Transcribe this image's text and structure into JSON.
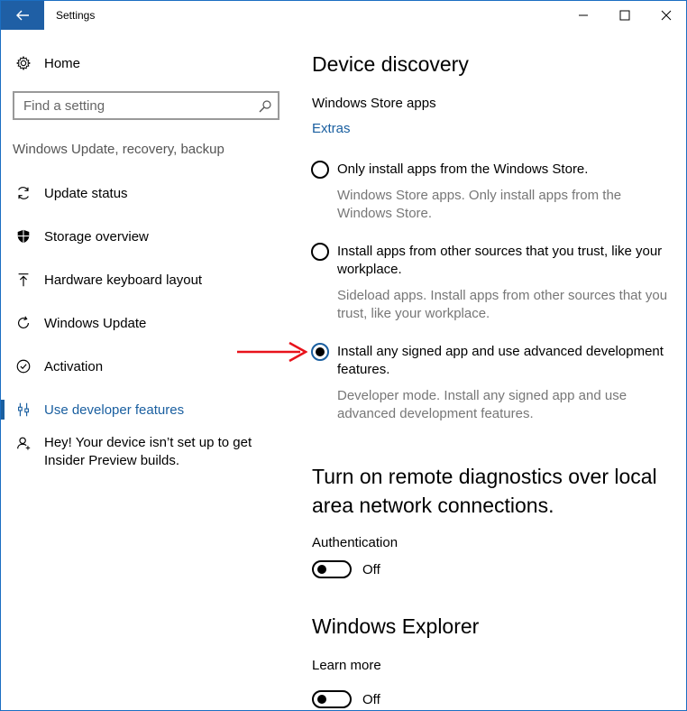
{
  "window": {
    "title": "Settings"
  },
  "sidebar": {
    "home_label": "Home",
    "search_placeholder": "Find a setting",
    "section_label": "Windows Update, recovery, backup",
    "items": [
      {
        "label": "Update status",
        "icon": "refresh-icon"
      },
      {
        "label": "Storage overview",
        "icon": "shield-icon"
      },
      {
        "label": "Hardware keyboard layout",
        "icon": "upload-arrow-icon"
      },
      {
        "label": "Windows Update",
        "icon": "sync-icon"
      },
      {
        "label": "Activation",
        "icon": "check-circle-icon"
      },
      {
        "label": "Use developer features",
        "icon": "developer-tools-icon",
        "active": true
      },
      {
        "label": "Hey! Your device isn’t set up to get Insider Preview builds.",
        "icon": "person-icon"
      }
    ]
  },
  "main": {
    "device_discovery": {
      "title": "Device discovery",
      "subtitle": "Windows Store apps",
      "link": "Extras",
      "options": [
        {
          "label": "Only install apps from the Windows Store.",
          "description": "Windows Store apps. Only install apps from the Windows Store.",
          "checked": false
        },
        {
          "label": "Install apps from other sources that you trust, like your workplace.",
          "description": "Sideload apps. Install apps from other sources that you trust, like your workplace.",
          "checked": false
        },
        {
          "label": "Install any signed app and use advanced development features.",
          "description": "Developer mode. Install any signed app and use advanced development features.",
          "checked": true
        }
      ]
    },
    "remote_diagnostics": {
      "title": "Turn on remote diagnostics over local area network connections.",
      "setting_label": "Authentication",
      "toggle_state": "Off"
    },
    "windows_explorer": {
      "title": "Windows Explorer",
      "setting_label": "Learn more",
      "toggle_state": "Off"
    }
  },
  "colors": {
    "accent": "#1a5fa0",
    "back_button": "#1f5fa5",
    "annotation_arrow": "#e8121b"
  }
}
